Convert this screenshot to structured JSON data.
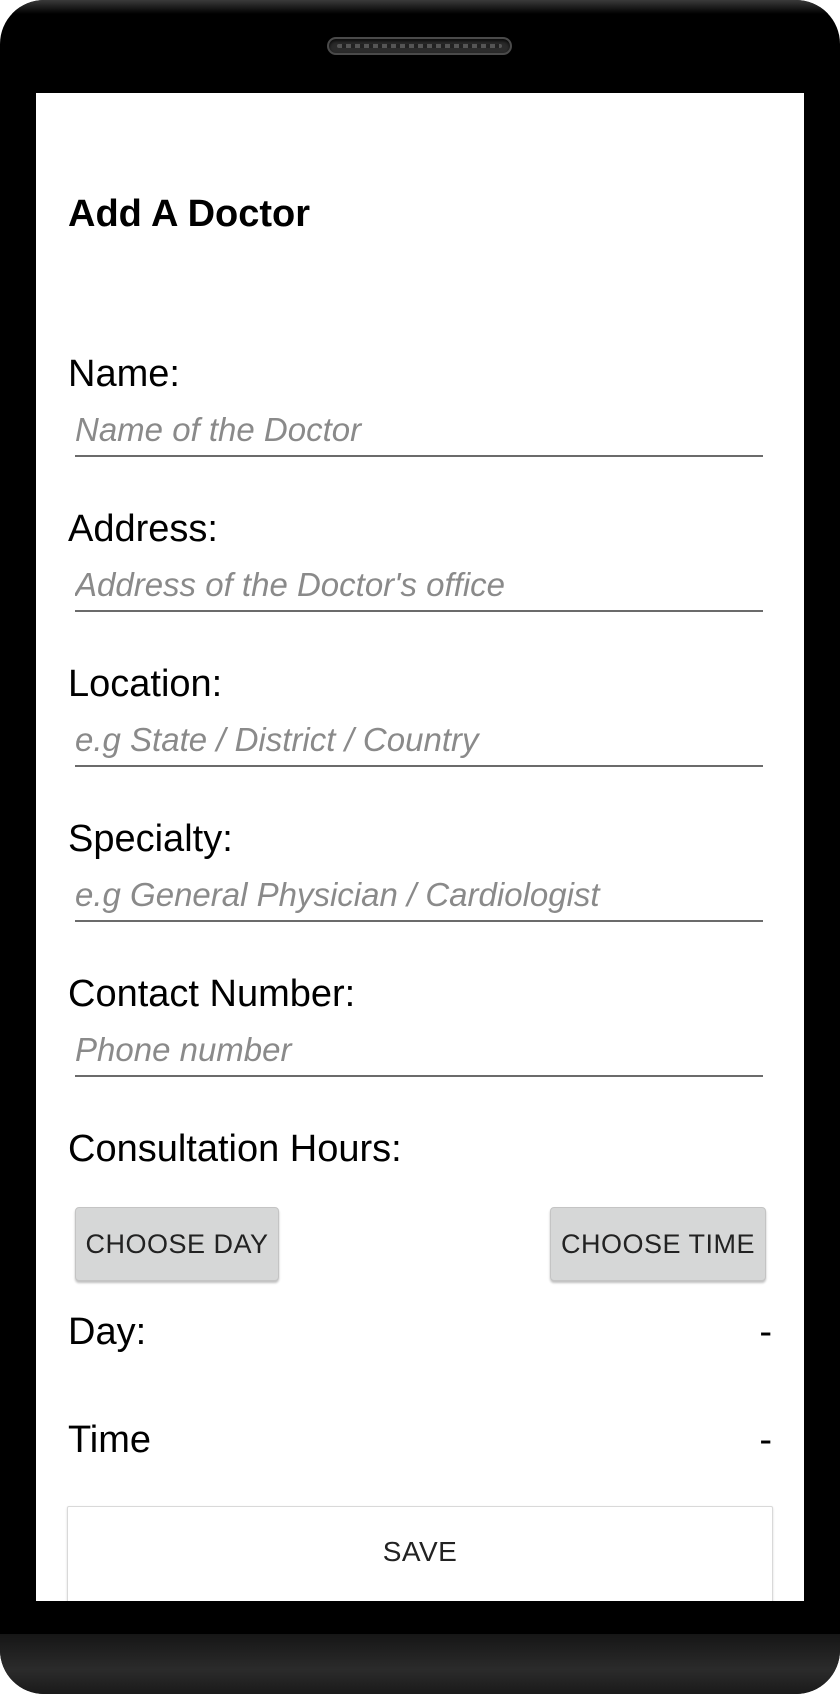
{
  "page": {
    "title": "Add A Doctor"
  },
  "form": {
    "name": {
      "label": "Name:",
      "value": "",
      "placeholder": "Name of the Doctor"
    },
    "address": {
      "label": "Address:",
      "value": "",
      "placeholder": "Address of the Doctor's office"
    },
    "location": {
      "label": "Location:",
      "value": "",
      "placeholder": "e.g State / District / Country"
    },
    "specialty": {
      "label": "Specialty:",
      "value": "",
      "placeholder": "e.g General Physician / Cardiologist"
    },
    "contact": {
      "label": "Contact Number:",
      "value": "",
      "placeholder": "Phone number"
    }
  },
  "consultation": {
    "label": "Consultation Hours:",
    "choose_day_label": "CHOOSE DAY",
    "choose_time_label": "CHOOSE TIME",
    "day": {
      "label": "Day:",
      "value": "-"
    },
    "time": {
      "label": "Time",
      "value": "-"
    }
  },
  "actions": {
    "save_label": "SAVE"
  },
  "colors": {
    "button_background": "#d6d7d7",
    "underline": "#6b6b6b",
    "placeholder": "#8a8a8a",
    "device_frame": "#000000"
  }
}
